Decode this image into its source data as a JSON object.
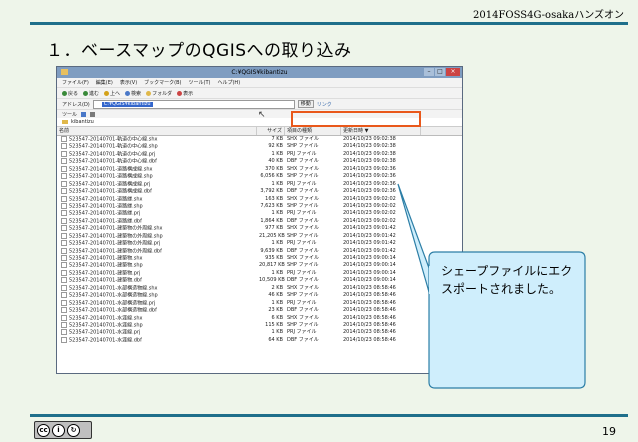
{
  "slide": {
    "header_text": "2014FOSS4G-osakaハンズオン",
    "title": "１．ベースマップのQGISへの取り込み",
    "page_number": "19",
    "cc_license": "cc by sa",
    "callout_text": "シェープファイルにエクスポートされました。"
  },
  "colors": {
    "accent": "#1f6f8b",
    "highlight": "#e9581b",
    "callout_fill": "#cfeefc",
    "callout_border": "#2c7ea6"
  },
  "explorer": {
    "window_title": "C:¥QGIS¥kibantizu",
    "menu": [
      "ファイル(F)",
      "編集(E)",
      "表示(V)",
      "ブックマーク(B)",
      "ツール(T)",
      "ヘルプ(H)"
    ],
    "toolbar": [
      "戻る",
      "進む",
      "上へ",
      "検索",
      "フォルダ",
      "表示"
    ],
    "address_label": "アドレス(D)",
    "address_value": "C:¥QGIS¥kibantizu",
    "go_label": "移動",
    "links_label": "リンク",
    "tools_label": "ツール",
    "tree_folder": "kibantizu",
    "columns": {
      "name": "名前",
      "size": "サイズ",
      "type": "項目の種類",
      "date": "更新日時 ▼"
    },
    "files": [
      {
        "name": "523547-20140701-軌道の中心線.shx",
        "size": "7 KB",
        "type": "SHX ファイル",
        "date": "2014/10/23 09:02:38"
      },
      {
        "name": "523547-20140701-軌道の中心線.shp",
        "size": "92 KB",
        "type": "SHP ファイル",
        "date": "2014/10/23 09:02:38"
      },
      {
        "name": "523547-20140701-軌道の中心線.prj",
        "size": "1 KB",
        "type": "PRJ ファイル",
        "date": "2014/10/23 09:02:38"
      },
      {
        "name": "523547-20140701-軌道の中心線.dbf",
        "size": "40 KB",
        "type": "DBF ファイル",
        "date": "2014/10/23 09:02:38"
      },
      {
        "name": "523547-20140701-道路構成線.shx",
        "size": "370 KB",
        "type": "SHX ファイル",
        "date": "2014/10/23 09:02:36"
      },
      {
        "name": "523547-20140701-道路構成線.shp",
        "size": "6,056 KB",
        "type": "SHP ファイル",
        "date": "2014/10/23 09:02:36"
      },
      {
        "name": "523547-20140701-道路構成線.prj",
        "size": "1 KB",
        "type": "PRJ ファイル",
        "date": "2014/10/23 09:02:36"
      },
      {
        "name": "523547-20140701-道路構成線.dbf",
        "size": "3,792 KB",
        "type": "DBF ファイル",
        "date": "2014/10/23 09:02:36"
      },
      {
        "name": "523547-20140701-道路縁.shx",
        "size": "163 KB",
        "type": "SHX ファイル",
        "date": "2014/10/23 09:02:02"
      },
      {
        "name": "523547-20140701-道路縁.shp",
        "size": "7,623 KB",
        "type": "SHP ファイル",
        "date": "2014/10/23 09:02:02"
      },
      {
        "name": "523547-20140701-道路縁.prj",
        "size": "1 KB",
        "type": "PRJ ファイル",
        "date": "2014/10/23 09:02:02"
      },
      {
        "name": "523547-20140701-道路縁.dbf",
        "size": "1,864 KB",
        "type": "DBF ファイル",
        "date": "2014/10/23 09:02:02"
      },
      {
        "name": "523547-20140701-建築物の外周線.shx",
        "size": "977 KB",
        "type": "SHX ファイル",
        "date": "2014/10/23 09:01:42"
      },
      {
        "name": "523547-20140701-建築物の外周線.shp",
        "size": "21,205 KB",
        "type": "SHP ファイル",
        "date": "2014/10/23 09:01:42"
      },
      {
        "name": "523547-20140701-建築物の外周線.prj",
        "size": "1 KB",
        "type": "PRJ ファイル",
        "date": "2014/10/23 09:01:42"
      },
      {
        "name": "523547-20140701-建築物の外周線.dbf",
        "size": "9,639 KB",
        "type": "DBF ファイル",
        "date": "2014/10/23 09:01:42"
      },
      {
        "name": "523547-20140701-建築物.shx",
        "size": "935 KB",
        "type": "SHX ファイル",
        "date": "2014/10/23 09:00:14"
      },
      {
        "name": "523547-20140701-建築物.shp",
        "size": "20,817 KB",
        "type": "SHP ファイル",
        "date": "2014/10/23 09:00:14"
      },
      {
        "name": "523547-20140701-建築物.prj",
        "size": "1 KB",
        "type": "PRJ ファイル",
        "date": "2014/10/23 09:00:14"
      },
      {
        "name": "523547-20140701-建築物.dbf",
        "size": "10,509 KB",
        "type": "DBF ファイル",
        "date": "2014/10/23 09:00:14"
      },
      {
        "name": "523547-20140701-水部構造物線.shx",
        "size": "2 KB",
        "type": "SHX ファイル",
        "date": "2014/10/23 08:58:46"
      },
      {
        "name": "523547-20140701-水部構造物線.shp",
        "size": "46 KB",
        "type": "SHP ファイル",
        "date": "2014/10/23 08:58:46"
      },
      {
        "name": "523547-20140701-水部構造物線.prj",
        "size": "1 KB",
        "type": "PRJ ファイル",
        "date": "2014/10/23 08:58:46"
      },
      {
        "name": "523547-20140701-水部構造物線.dbf",
        "size": "23 KB",
        "type": "DBF ファイル",
        "date": "2014/10/23 08:58:46"
      },
      {
        "name": "523547-20140701-水涯線.shx",
        "size": "6 KB",
        "type": "SHX ファイル",
        "date": "2014/10/23 08:58:46"
      },
      {
        "name": "523547-20140701-水涯線.shp",
        "size": "115 KB",
        "type": "SHP ファイル",
        "date": "2014/10/23 08:58:46"
      },
      {
        "name": "523547-20140701-水涯線.prj",
        "size": "1 KB",
        "type": "PRJ ファイル",
        "date": "2014/10/23 08:58:46"
      },
      {
        "name": "523547-20140701-水涯線.dbf",
        "size": "64 KB",
        "type": "DBF ファイル",
        "date": "2014/10/23 08:58:46"
      }
    ]
  }
}
